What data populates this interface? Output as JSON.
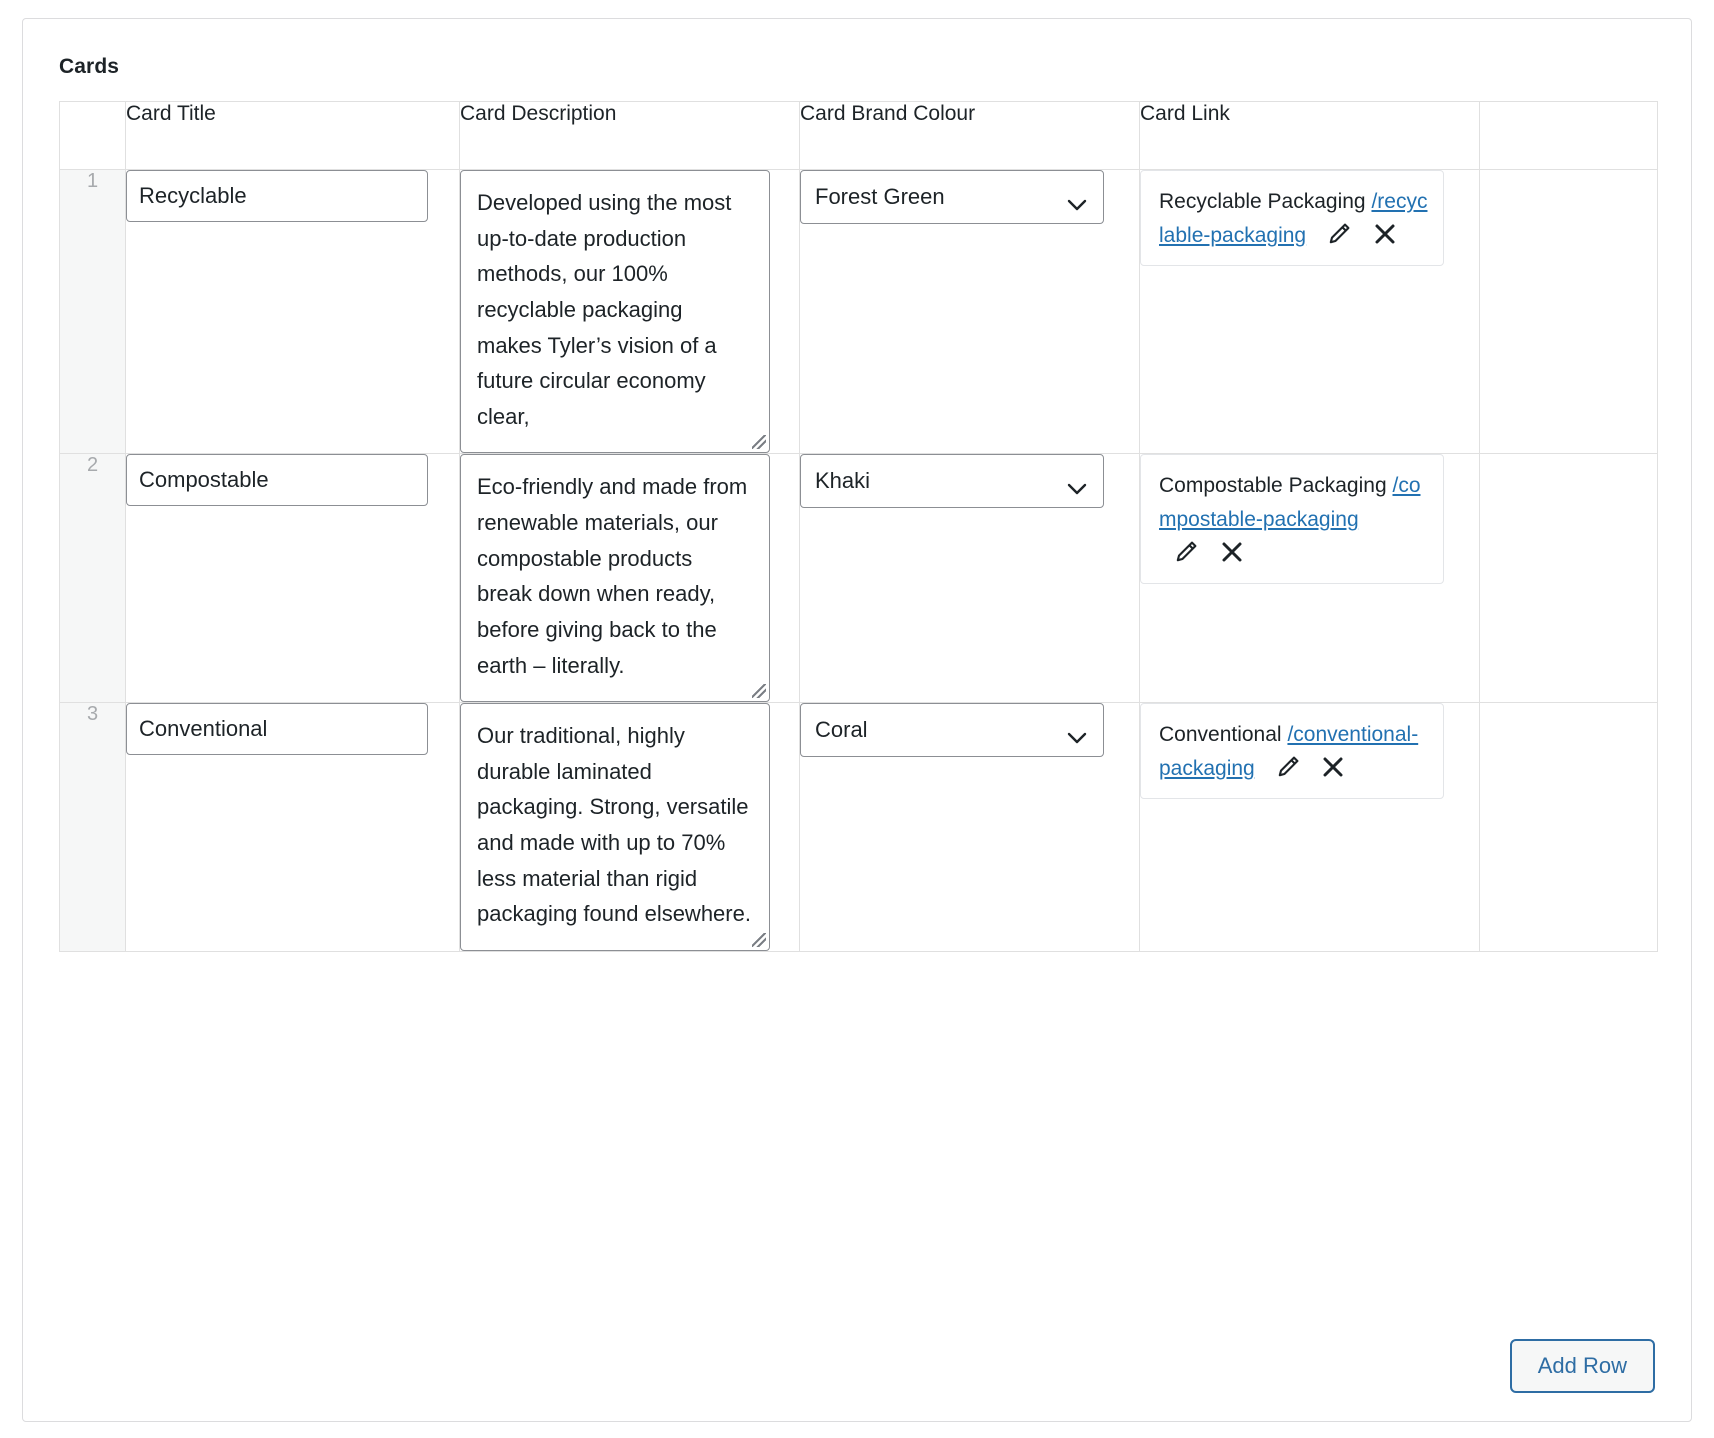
{
  "panel": {
    "label": "Cards"
  },
  "table": {
    "columns": [
      {
        "key": "order",
        "label": ""
      },
      {
        "key": "title",
        "label": "Card Title"
      },
      {
        "key": "description",
        "label": "Card Description"
      },
      {
        "key": "brand_colour",
        "label": "Card Brand Colour"
      },
      {
        "key": "link",
        "label": "Card Link"
      },
      {
        "key": "tools",
        "label": ""
      }
    ],
    "rows": [
      {
        "order": "1",
        "title": "Recyclable",
        "description": "Developed using the most up-to-date production methods, our 100% recyclable packaging makes Tyler’s vision of a future circular economy clear,",
        "brand_colour": "Forest Green",
        "link_title": "Recyclable Packaging",
        "link_url": "/recyclable-packaging"
      },
      {
        "order": "2",
        "title": "Compostable",
        "description": "Eco-friendly and made from renewable materials, our compostable products break down when ready, before giving back to the earth – literally.",
        "brand_colour": "Khaki",
        "link_title": "Compostable Packaging",
        "link_url": "/compostable-packaging"
      },
      {
        "order": "3",
        "title": "Conventional",
        "description": "Our traditional, highly durable laminated packaging. Strong, versatile and made with up to 70% less material than rigid packaging found elsewhere.",
        "brand_colour": "Coral",
        "link_title": "Conventional",
        "link_url": "/conventional-packaging"
      }
    ]
  },
  "icons": {
    "edit": "pencil-icon",
    "remove": "close-icon",
    "select_arrow": "chevron-down-icon"
  },
  "footer": {
    "add_row_label": "Add Row"
  },
  "colors": {
    "link": "#2271b1",
    "button_border": "#2e6da4",
    "field_border": "#8c8f94",
    "row_header_bg": "#f6f7f7",
    "text": "#1d2327"
  }
}
